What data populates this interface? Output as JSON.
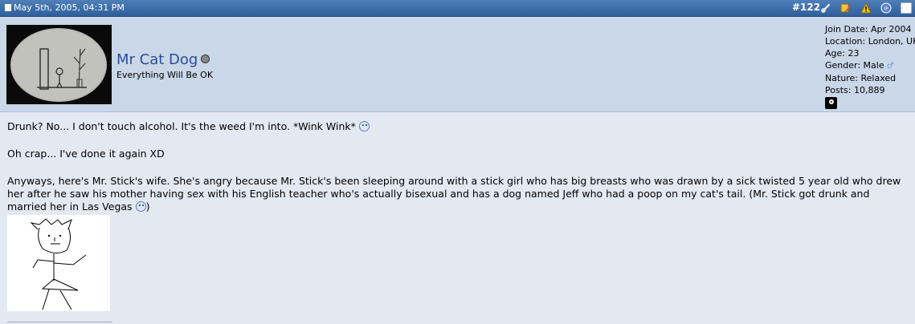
{
  "post": {
    "date": "May 5th, 2005, 04:31 PM",
    "number": "#122"
  },
  "user": {
    "name": "Mr Cat Dog",
    "title": "Everything Will Be OK",
    "join_date": "Join Date: Apr 2004",
    "location": "Location: London, UK",
    "age": "Age: 23",
    "gender": "Gender: Male",
    "nature": "Nature: Relaxed",
    "posts": "Posts: 10,889"
  },
  "body": {
    "line1": "Drunk? No... I don't touch alcohol. It's the weed I'm into. *Wink Wink*",
    "line2": "Oh crap... I've done it again XD",
    "line3": "Anyways, here's Mr. Stick's wife. She's angry because Mr. Stick's been sleeping around with a stick girl who has big breasts who was drawn by a sick twisted 5 year old who drew her after he saw his mother having sex with his English teacher who's actually bisexual and has a dog named Jeff who had a poop on my cat's tail. (Mr. Stick got drunk and married her in Las Vegas",
    "line3_end": ")"
  },
  "icons": [
    "document-icon",
    "link-icon",
    "edit-icon",
    "warning-icon",
    "ip-icon",
    "checkbox",
    "online-status-icon",
    "male-icon",
    "steam-icon",
    "smiley-icon"
  ]
}
